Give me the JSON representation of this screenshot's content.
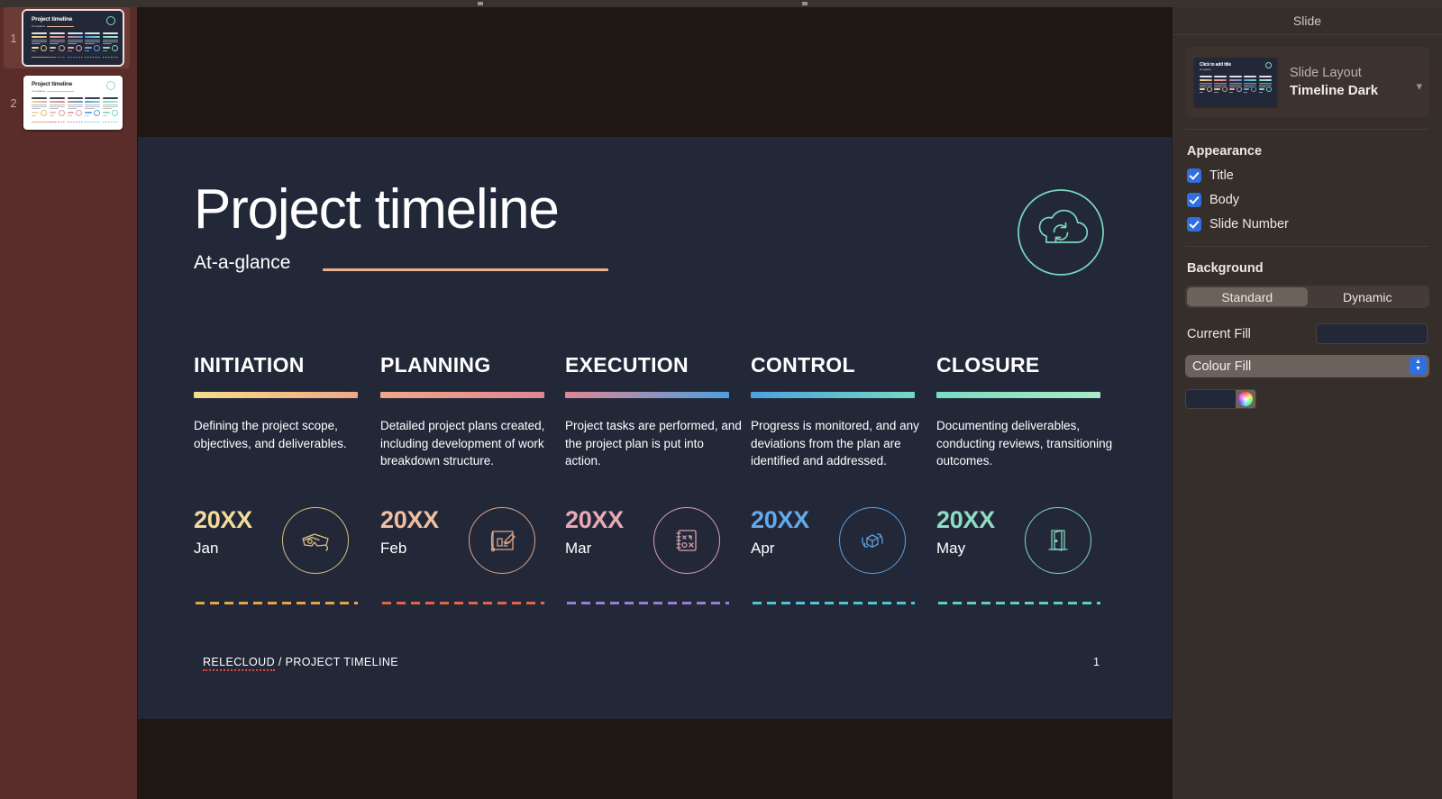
{
  "window": {
    "top_strip": ""
  },
  "navigator": {
    "slides": [
      {
        "number": "1",
        "theme": "dark",
        "selected": true
      },
      {
        "number": "2",
        "theme": "light",
        "selected": false
      }
    ]
  },
  "slide": {
    "title": "Project timeline",
    "subtitle": "At-a-glance",
    "cloud_icon": "cloud-sync-icon",
    "rule_color": "#e9b393",
    "background_color": "#232839",
    "footer": {
      "brand": "RELECLOUD",
      "separator": " / ",
      "section": "PROJECT TIMELINE",
      "page_number": "1"
    },
    "phases": [
      {
        "heading": "INITIATION",
        "bar_from": "#f6dd8b",
        "bar_to": "#efa886",
        "description": "Defining the project scope, objectives, and deliverables.",
        "year": "20XX",
        "month": "Jan",
        "year_color": "#f3dc9a",
        "accent": "#d9c07f",
        "icon": "3d-glasses-icon",
        "dash_color": "#e8a34a"
      },
      {
        "heading": "PLANNING",
        "bar_from": "#efa886",
        "bar_to": "#dc8795",
        "description": "Detailed project plans created, including development of work breakdown structure.",
        "year": "20XX",
        "month": "Feb",
        "year_color": "#f0bfa2",
        "accent": "#d8a58c",
        "icon": "blueprint-pencil-icon",
        "dash_color": "#e2654a"
      },
      {
        "heading": "EXECUTION",
        "bar_from": "#dc8795",
        "bar_to": "#4ea0e0",
        "description": "Project tasks are performed, and the project plan is put into action.",
        "year": "20XX",
        "month": "Mar",
        "year_color": "#e8a9b4",
        "accent": "#d9a0ad",
        "icon": "strategy-notebook-icon",
        "dash_color": "#9b7fcf"
      },
      {
        "heading": "CONTROL",
        "bar_from": "#4ea0e0",
        "bar_to": "#76d8c0",
        "description": "Progress is monitored, and any deviations from the plan are identified and addressed.",
        "year": "20XX",
        "month": "Apr",
        "year_color": "#64a9e8",
        "accent": "#5e9fdd",
        "icon": "package-refresh-icon",
        "dash_color": "#4fc6d8"
      },
      {
        "heading": "CLOSURE",
        "bar_from": "#79dcc0",
        "bar_to": "#a9ecc9",
        "description": "Documenting deliverables, conducting reviews, transitioning outcomes.",
        "year": "20XX",
        "month": "May",
        "year_color": "#8fdcc3",
        "accent": "#7fd4b9",
        "icon": "open-door-icon",
        "dash_color": "#5fd0b4"
      }
    ]
  },
  "inspector": {
    "header": "Slide",
    "layout": {
      "label": "Slide Layout",
      "value": "Timeline Dark",
      "thumb_placeholder_title": "Click to add title",
      "chevron": "chevron-down-icon"
    },
    "appearance": {
      "title": "Appearance",
      "options": [
        {
          "label": "Title",
          "checked": true
        },
        {
          "label": "Body",
          "checked": true
        },
        {
          "label": "Slide Number",
          "checked": true
        }
      ]
    },
    "background": {
      "title": "Background",
      "segments": [
        {
          "label": "Standard",
          "selected": true
        },
        {
          "label": "Dynamic",
          "selected": false
        }
      ],
      "current_fill_label": "Current Fill",
      "current_fill_color": "#232839",
      "fill_type": "Colour Fill",
      "fill_color": "#232839"
    }
  }
}
